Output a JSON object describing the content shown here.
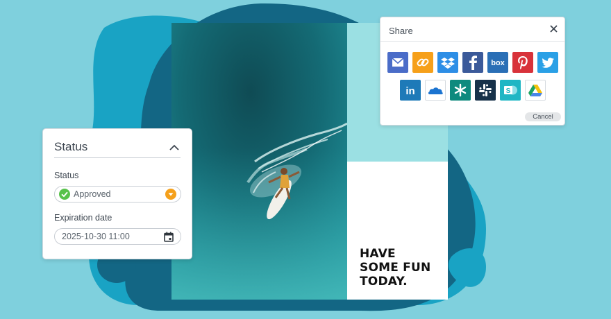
{
  "poster": {
    "tagline": [
      "HAVE",
      "SOME FUN",
      "TODAY."
    ]
  },
  "status_panel": {
    "title": "Status",
    "collapse_icon": "chevron-up-icon",
    "status_field": {
      "label": "Status",
      "value": "Approved",
      "status_icon": "check-circle-icon",
      "status_color": "#58c24b",
      "dropdown_icon": "orange-dropdown-icon",
      "dropdown_color": "#f5a01b"
    },
    "expiration_field": {
      "label": "Expiration date",
      "value": "2025-10-30 11:00",
      "icon": "calendar-icon"
    }
  },
  "share_dialog": {
    "title": "Share",
    "close_icon": "close-icon",
    "cancel_label": "Cancel",
    "row1": [
      {
        "icon": "email-icon",
        "color": "#4a6cc8"
      },
      {
        "icon": "link-icon",
        "color": "#f6a01a"
      },
      {
        "icon": "dropbox-icon",
        "color": "#2d8ee6"
      },
      {
        "icon": "facebook-icon",
        "color": "#3b5a9a"
      },
      {
        "icon": "box-icon",
        "color": "#2a6fb6",
        "text": "box"
      },
      {
        "icon": "pinterest-icon",
        "color": "#d8323a"
      },
      {
        "icon": "twitter-icon",
        "color": "#2aa0e6"
      }
    ],
    "row2": [
      {
        "icon": "linkedin-icon",
        "color": "#1e7ab8",
        "text": "in"
      },
      {
        "icon": "onedrive-icon",
        "color": "#1a73d0"
      },
      {
        "icon": "asterisk-icon",
        "color": "#0e8a7e"
      },
      {
        "icon": "slack-icon",
        "color": "#17324a"
      },
      {
        "icon": "sharepoint-icon",
        "color": "#1fb6c4",
        "text": "S"
      },
      {
        "icon": "google-drive-icon",
        "color": "#f4c20d"
      }
    ]
  },
  "colors": {
    "background": "#7fd0dd",
    "blob_dark": "#1a6a88",
    "blob_mid": "#1fa0c2",
    "poster_teal": "#9be0e3"
  }
}
